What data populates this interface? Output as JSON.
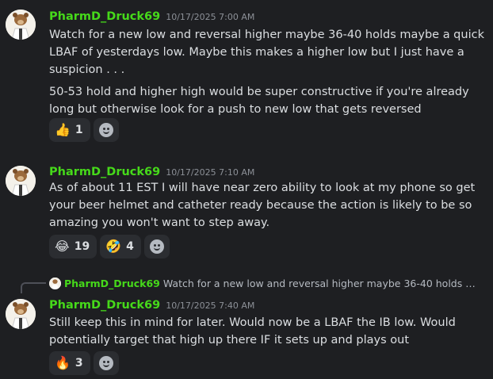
{
  "messages": [
    {
      "username": "PharmD_Druck69",
      "timestamp": "10/17/2025 7:00 AM",
      "paragraphs": [
        "Watch for a new low and reversal higher maybe 36-40 holds maybe a quick LBAF of yesterdays low. Maybe this makes a higher low but I just have a suspicion . . .",
        "50-53 hold and higher high would be super constructive if you're already long but otherwise look for a push to new low that gets reversed"
      ],
      "reactions": [
        {
          "emoji": "👍",
          "icon": "thumbs-up-icon",
          "count": "1"
        }
      ]
    },
    {
      "username": "PharmD_Druck69",
      "timestamp": "10/17/2025 7:10 AM",
      "paragraphs": [
        "As of about 11 EST I will have near zero ability to look at my phone so get your beer helmet and catheter ready because the action is likely to be so amazing you won't want to step away."
      ],
      "reactions": [
        {
          "emoji": "😂",
          "icon": "tears-of-joy-icon",
          "count": "19"
        },
        {
          "emoji": "🤣",
          "icon": "rofl-icon",
          "count": "4"
        }
      ]
    },
    {
      "reply": {
        "username": "PharmD_Druck69",
        "text": "Watch for a new low and reversal higher maybe 36-40 holds may..."
      },
      "username": "PharmD_Druck69",
      "timestamp": "10/17/2025 7:40 AM",
      "paragraphs": [
        "Still keep this in mind for later. Would now be a LBAF the IB low. Would potentially target that high up there IF it sets up and plays out"
      ],
      "reactions": [
        {
          "emoji": "🔥",
          "icon": "fire-icon",
          "count": "3"
        }
      ]
    }
  ],
  "colors": {
    "background": "#1e1f22",
    "username": "#46d91a",
    "reaction_bg": "#2b2d31"
  }
}
